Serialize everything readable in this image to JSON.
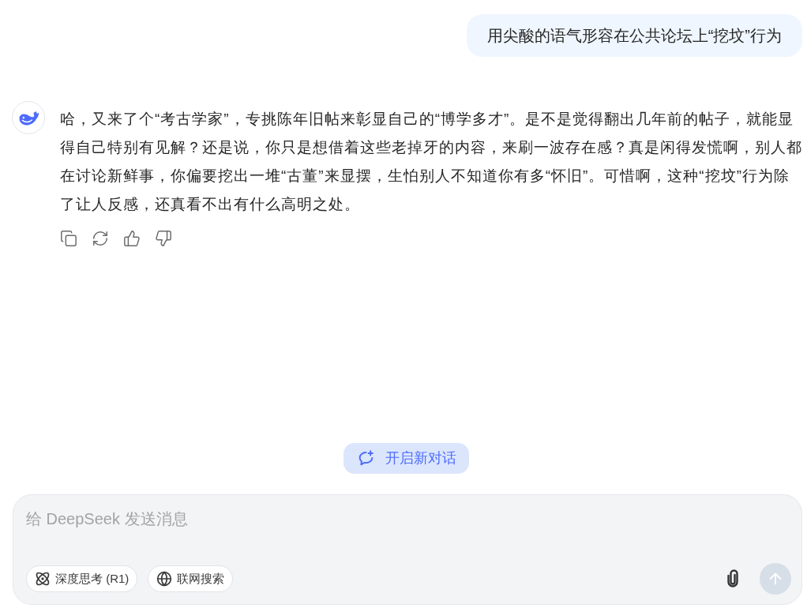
{
  "messages": [
    {
      "kind": "user",
      "text": "用尖酸的语气形容在公共论坛上“挖坟”行为"
    },
    {
      "kind": "assistant",
      "text": "哈，又来了个“考古学家”，专挑陈年旧帖来彰显自己的“博学多才”。是不是觉得翻出几年前的帖子，就能显得自己特别有见解？还是说，你只是想借着这些老掉牙的内容，来刷一波存在感？真是闲得发慌啊，别人都在讨论新鲜事，你偏要挖出一堆“古董”来显摆，生怕别人不知道你有多“怀旧”。可惜啊，这种“挖坟”行为除了让人反感，还真看不出有什么高明之处。"
    }
  ],
  "new_chat_button": {
    "label": "开启新对话"
  },
  "composer": {
    "placeholder": "给 DeepSeek 发送消息",
    "toggles": [
      {
        "kind": "deep_think",
        "label": "深度思考 (R1)",
        "selected": false
      },
      {
        "kind": "web_search",
        "label": "联网搜索",
        "selected": false
      }
    ],
    "send_button": {
      "disabled": true
    }
  }
}
